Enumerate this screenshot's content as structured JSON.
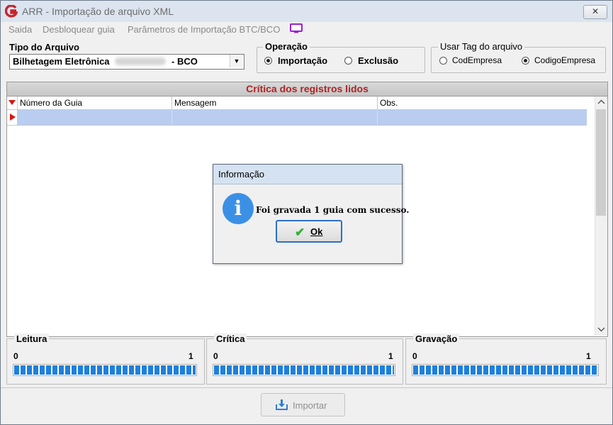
{
  "window": {
    "title": "ARR - Importação de arquivo XML",
    "close_label": "✕"
  },
  "menu": {
    "items": [
      "Saida",
      "Desbloquear guia",
      "Parâmetros de Importação BTC/BCO"
    ]
  },
  "tipo_arquivo": {
    "label": "Tipo do Arquivo",
    "value": "Bilhetagem Eletrônica",
    "suffix": "- BCO"
  },
  "operacao": {
    "label": "Operação",
    "options": [
      "Importação",
      "Exclusão"
    ],
    "selected": "Importação"
  },
  "usar_tag": {
    "label": "Usar Tag do arquivo",
    "options": [
      "CodEmpresa",
      "CodigoEmpresa"
    ],
    "selected": "CodigoEmpresa"
  },
  "grid": {
    "title": "Crítica dos registros lidos",
    "columns": [
      "Número da Guia",
      "Mensagem",
      "Obs."
    ],
    "rows": [
      [
        "",
        "",
        ""
      ]
    ]
  },
  "dialog": {
    "title": "Informação",
    "message": "Foi gravada 1 guia com sucesso.",
    "ok_label": "Ok"
  },
  "progress": [
    {
      "label": "Leitura",
      "min": "0",
      "max": "1",
      "value": 1
    },
    {
      "label": "Crítica",
      "min": "0",
      "max": "1",
      "value": 1
    },
    {
      "label": "Gravação",
      "min": "0",
      "max": "1",
      "value": 1
    }
  ],
  "import_button": {
    "label": "Importar",
    "enabled": false
  },
  "colors": {
    "accent": "#1e80dc",
    "grid_title": "#b22222",
    "selected_row": "#b9cdf0",
    "info_icon": "#3b90e6"
  }
}
